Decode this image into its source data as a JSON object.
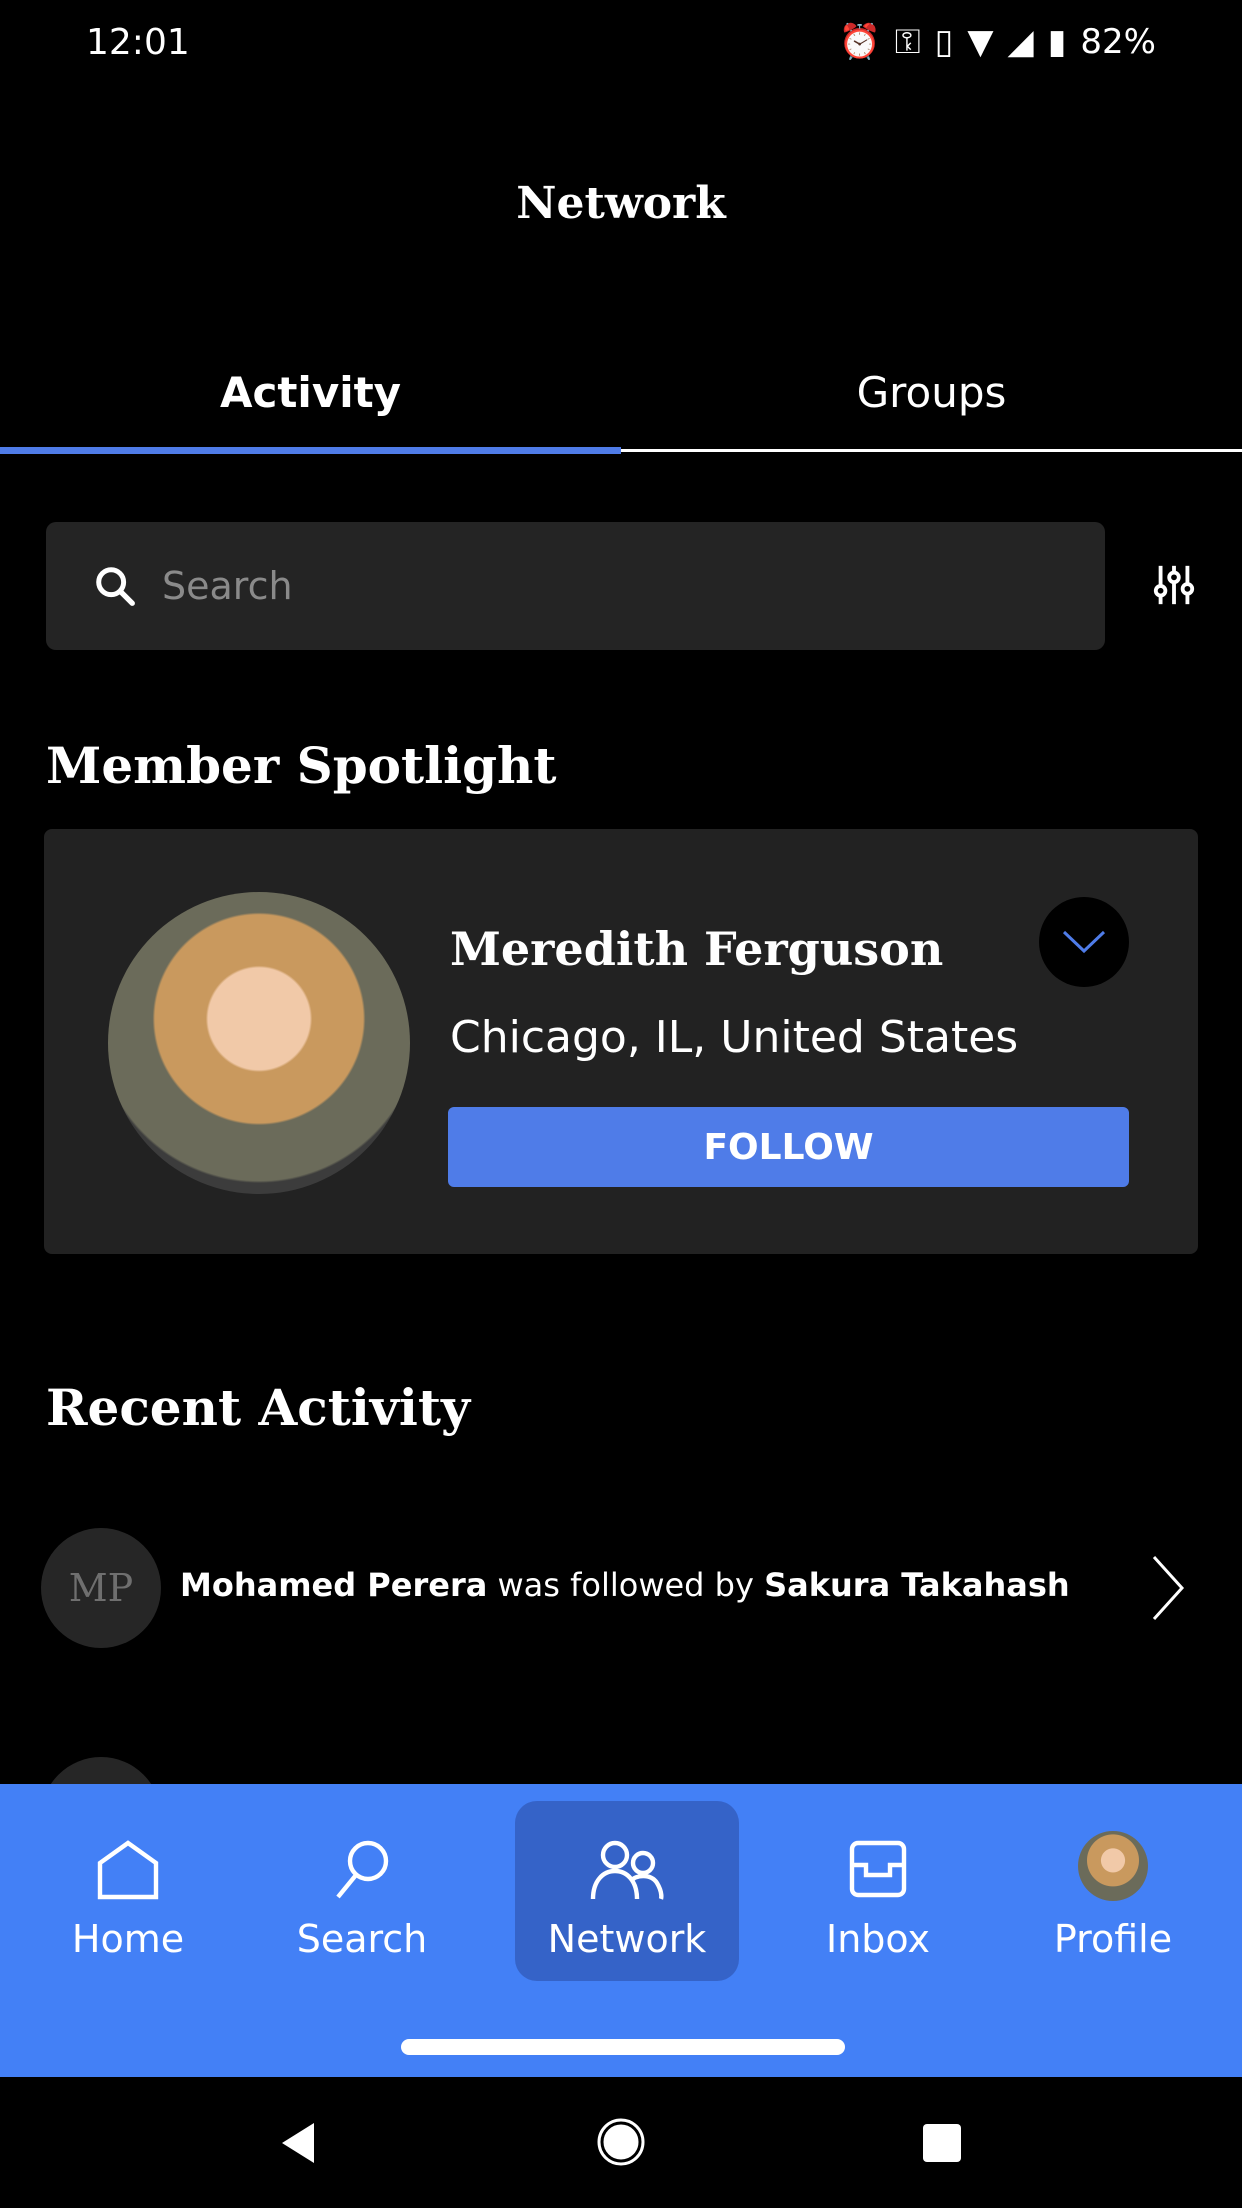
{
  "status_bar": {
    "time": "12:01",
    "battery": "82%",
    "icons": [
      "alarm-icon",
      "vpn-key-icon",
      "vibrate-icon",
      "wifi-icon",
      "signal-icon",
      "battery-icon"
    ]
  },
  "header": {
    "title": "Network"
  },
  "tabs": [
    {
      "label": "Activity",
      "active": true
    },
    {
      "label": "Groups",
      "active": false
    }
  ],
  "search": {
    "placeholder": "Search",
    "value": ""
  },
  "spotlight": {
    "heading": "Member Spotlight",
    "name": "Meredith Ferguson",
    "location": "Chicago, IL, United States",
    "follow_label": "FOLLOW"
  },
  "recent": {
    "heading": "Recent Activity",
    "items": [
      {
        "initials": "MP",
        "actor": "Mohamed Perera",
        "action": " was followed by ",
        "target": "Sakura Takahash"
      }
    ]
  },
  "bottom_nav": [
    {
      "label": "Home",
      "icon": "home-icon"
    },
    {
      "label": "Search",
      "icon": "search-icon"
    },
    {
      "label": "Network",
      "icon": "people-icon",
      "active": true
    },
    {
      "label": "Inbox",
      "icon": "inbox-icon"
    },
    {
      "label": "Profile",
      "icon": "avatar"
    }
  ],
  "colors": {
    "accent": "#4f7ce8",
    "nav_bg": "#4380f6",
    "nav_active": "#3563c8",
    "card": "#222222"
  }
}
